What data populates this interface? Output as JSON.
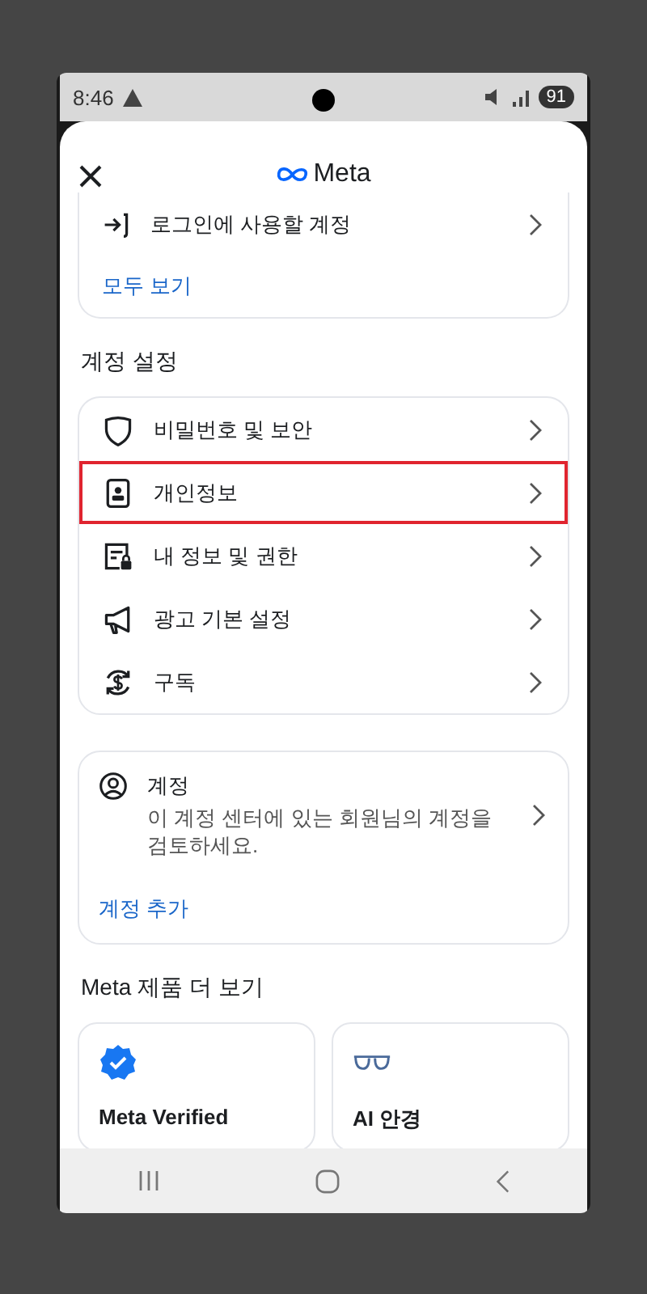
{
  "status_bar": {
    "time": "8:46",
    "battery": "91"
  },
  "header": {
    "brand": "Meta"
  },
  "login_card": {
    "items": [
      {
        "label": "로그인에 사용할 계정"
      }
    ],
    "link": "모두 보기"
  },
  "account_settings": {
    "title": "계정 설정",
    "items": [
      {
        "label": "비밀번호 및 보안",
        "kind": "shield",
        "highlighted": false
      },
      {
        "label": "개인정보",
        "kind": "id-card",
        "highlighted": true
      },
      {
        "label": "내 정보 및 권한",
        "kind": "info-lock",
        "highlighted": false
      },
      {
        "label": "광고 기본 설정",
        "kind": "megaphone",
        "highlighted": false
      },
      {
        "label": "구독",
        "kind": "subscription",
        "highlighted": false
      }
    ]
  },
  "accounts_card": {
    "title": "계정",
    "description": "이 계정 센터에 있는 회원님의 계정을 검토하세요.",
    "link": "계정 추가"
  },
  "more_products": {
    "title": "Meta 제품 더 보기",
    "items": [
      {
        "label": "Meta Verified",
        "kind": "verified"
      },
      {
        "label": "AI 안경",
        "kind": "glasses"
      }
    ]
  }
}
